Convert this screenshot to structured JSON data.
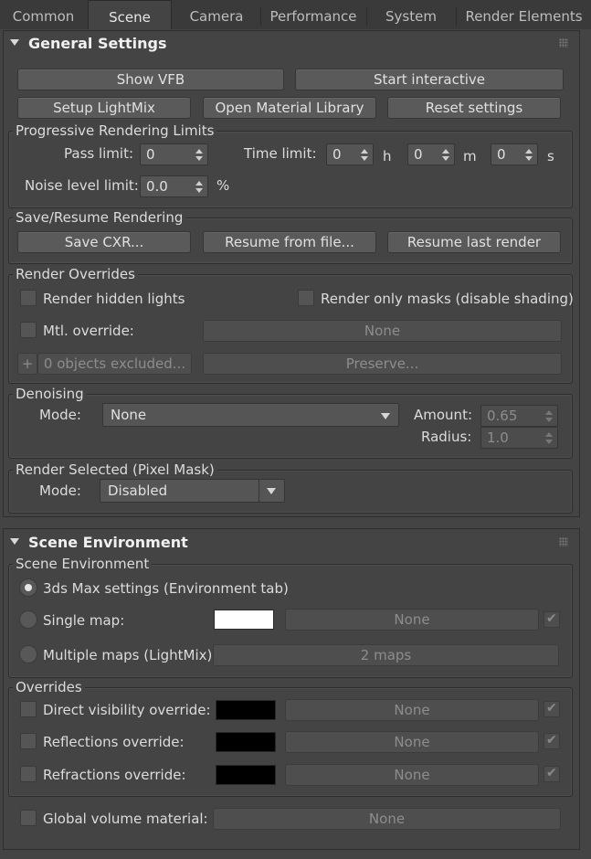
{
  "tabs": [
    "Common",
    "Scene",
    "Camera",
    "Performance",
    "System",
    "Render Elements"
  ],
  "general": {
    "title": "General Settings",
    "buttons": {
      "show_vfb": "Show VFB",
      "start_interactive": "Start interactive",
      "setup_lightmix": "Setup LightMix",
      "open_material_library": "Open Material Library",
      "reset_settings": "Reset settings"
    },
    "limits": {
      "title": "Progressive Rendering Limits",
      "pass_label": "Pass limit:",
      "pass_value": "0",
      "time_label": "Time limit:",
      "h_value": "0",
      "h_unit": "h",
      "m_value": "0",
      "m_unit": "m",
      "s_value": "0",
      "s_unit": "s",
      "noise_label": "Noise level limit:",
      "noise_value": "0.0",
      "noise_unit": "%"
    },
    "save_resume": {
      "title": "Save/Resume Rendering",
      "save_cxr": "Save CXR...",
      "resume_file": "Resume from file...",
      "resume_last": "Resume last render"
    },
    "overrides": {
      "title": "Render Overrides",
      "hidden_lights": "Render hidden lights",
      "only_masks": "Render only masks (disable shading)",
      "mtl_override": "Mtl. override:",
      "mtl_value": "None",
      "plus": "+",
      "excluded": "0 objects excluded...",
      "preserve": "Preserve..."
    },
    "denoising": {
      "title": "Denoising",
      "mode_label": "Mode:",
      "mode_value": "None",
      "amount_label": "Amount:",
      "amount_value": "0.65",
      "radius_label": "Radius:",
      "radius_value": "1.0"
    },
    "render_selected": {
      "title": "Render Selected (Pixel Mask)",
      "mode_label": "Mode:",
      "mode_value": "Disabled"
    }
  },
  "scene_env": {
    "title": "Scene Environment",
    "group_title": "Scene Environment",
    "max_settings": "3ds Max settings (Environment tab)",
    "single_map": "Single map:",
    "single_map_value": "None",
    "multiple_maps": "Multiple maps (LightMix):",
    "multiple_maps_value": "2 maps",
    "overrides_title": "Overrides",
    "direct_vis": "Direct visibility override:",
    "direct_vis_value": "None",
    "reflections": "Reflections override:",
    "reflections_value": "None",
    "refractions": "Refractions override:",
    "refractions_value": "None",
    "global_volume": "Global volume material:",
    "global_volume_value": "None",
    "colors": {
      "single_map_swatch": "#ffffff",
      "override_swatch": "#000000"
    }
  }
}
